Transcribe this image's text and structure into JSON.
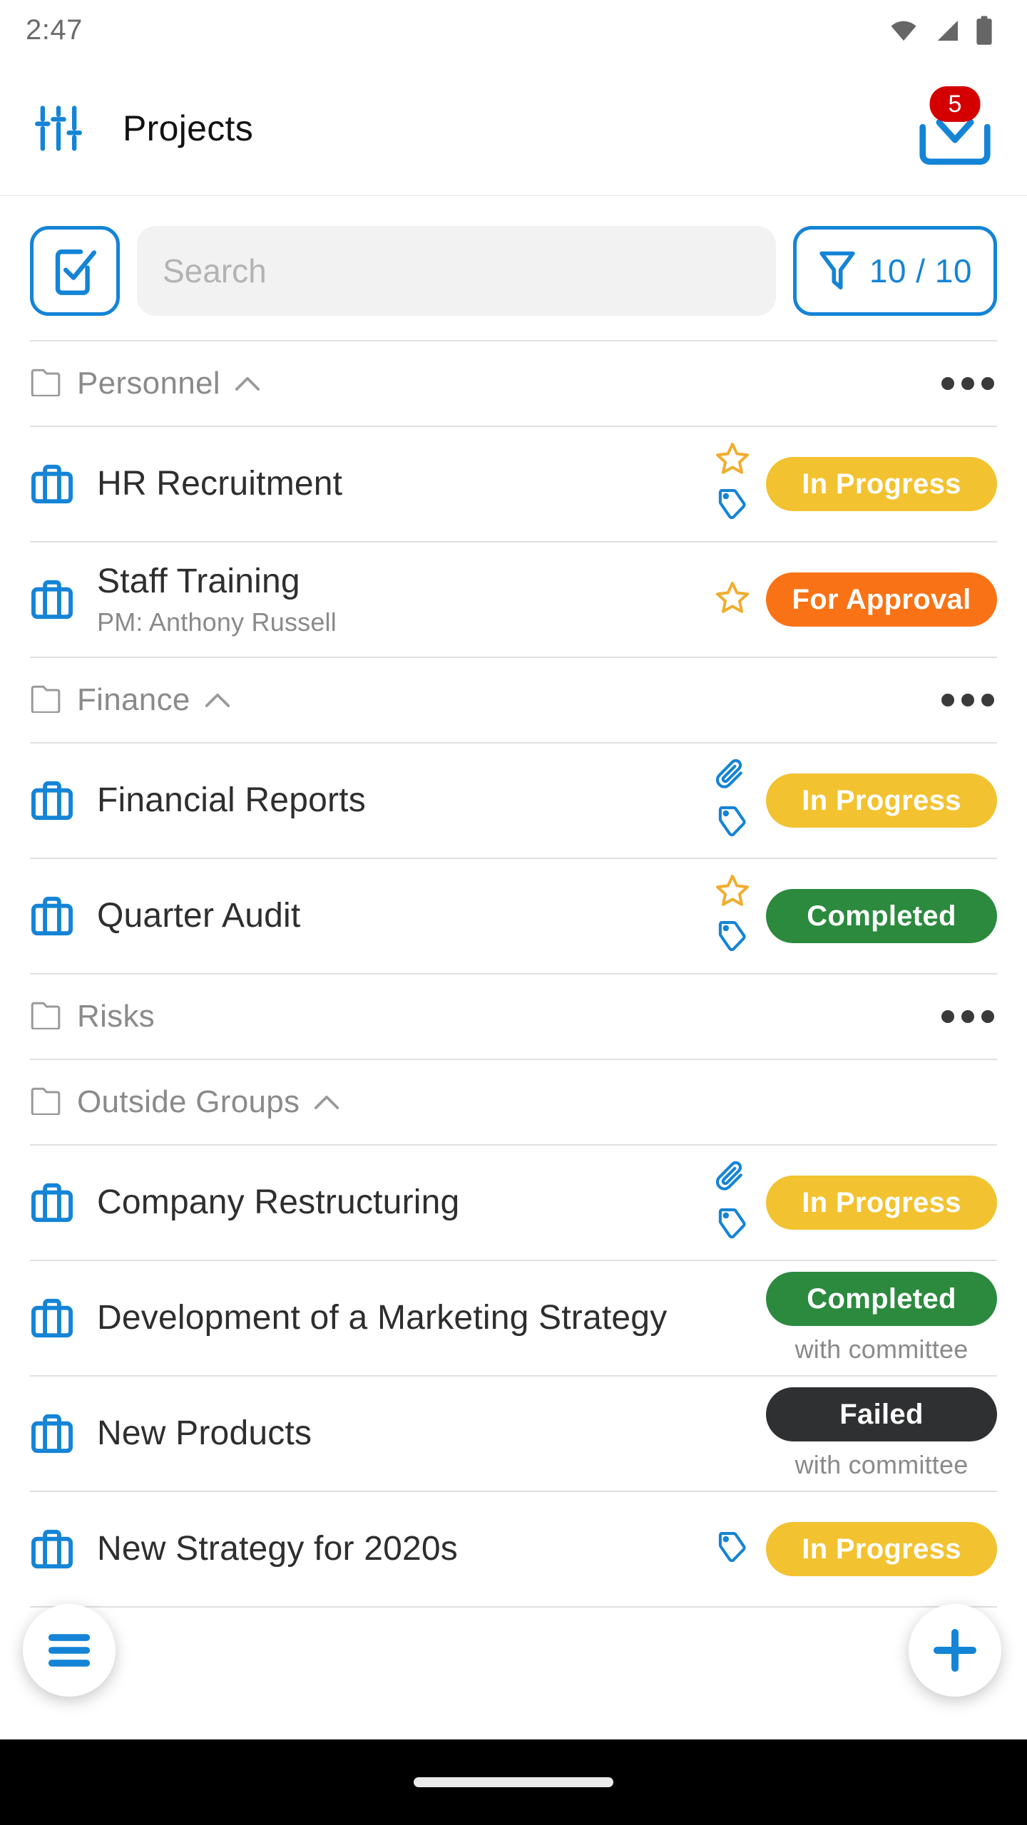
{
  "status_bar": {
    "time": "2:47",
    "icons": [
      "wifi-icon",
      "cellular-signal-icon",
      "battery-icon"
    ]
  },
  "app_bar": {
    "menu_icon": "sliders-icon",
    "title": "Projects",
    "inbox_icon": "inbox-download-icon",
    "inbox_badge": "5"
  },
  "toolbar": {
    "select_icon": "checkbox-select-icon",
    "search_placeholder": "Search",
    "search_value": "",
    "filter_icon": "funnel-filter-icon",
    "filter_count": "10 / 10"
  },
  "colors": {
    "accent_blue": "#1484d6",
    "in_progress": "#f2c230",
    "for_approval": "#f97316",
    "completed": "#2b8a3e",
    "failed": "#2f3031",
    "badge_red": "#d40000",
    "star_gold": "#f0ad2e",
    "muted_gray": "#8a8a8a"
  },
  "groups": [
    {
      "name": "Personnel",
      "folder_icon": "folder-icon",
      "collapsible": true,
      "expanded": true,
      "has_menu": true,
      "projects": [
        {
          "title": "HR Recruitment",
          "subtitle": "",
          "icon": "briefcase-icon",
          "marks": [
            "star-icon",
            "tag-icon"
          ],
          "status": "In Progress",
          "status_color": "#f2c230",
          "status_note": ""
        },
        {
          "title": "Staff Training",
          "subtitle": "PM: Anthony Russell",
          "icon": "briefcase-icon",
          "marks": [
            "star-icon"
          ],
          "status": "For Approval",
          "status_color": "#f97316",
          "status_note": ""
        }
      ]
    },
    {
      "name": "Finance",
      "folder_icon": "folder-icon",
      "collapsible": true,
      "expanded": true,
      "has_menu": true,
      "projects": [
        {
          "title": "Financial Reports",
          "subtitle": "",
          "icon": "briefcase-icon",
          "marks": [
            "paperclip-icon",
            "tag-icon"
          ],
          "status": "In Progress",
          "status_color": "#f2c230",
          "status_note": ""
        },
        {
          "title": "Quarter Audit",
          "subtitle": "",
          "icon": "briefcase-icon",
          "marks": [
            "star-icon",
            "tag-icon"
          ],
          "status": "Completed",
          "status_color": "#2b8a3e",
          "status_note": ""
        }
      ]
    },
    {
      "name": "Risks",
      "folder_icon": "folder-icon",
      "collapsible": false,
      "expanded": false,
      "has_menu": true,
      "projects": []
    },
    {
      "name": "Outside Groups",
      "folder_icon": "folder-icon",
      "collapsible": true,
      "expanded": true,
      "has_menu": false,
      "projects": [
        {
          "title": "Company Restructuring",
          "subtitle": "",
          "icon": "briefcase-icon",
          "marks": [
            "paperclip-icon",
            "tag-icon"
          ],
          "status": "In Progress",
          "status_color": "#f2c230",
          "status_note": ""
        },
        {
          "title": "Development of a Marketing Strategy",
          "subtitle": "",
          "icon": "briefcase-icon",
          "marks": [],
          "status": "Completed",
          "status_color": "#2b8a3e",
          "status_note": "with committee"
        },
        {
          "title": "New Products",
          "subtitle": "",
          "icon": "briefcase-icon",
          "marks": [],
          "status": "Failed",
          "status_color": "#2f3031",
          "status_note": "with committee"
        },
        {
          "title": "New Strategy for 2020s",
          "subtitle": "",
          "icon": "briefcase-icon",
          "marks": [
            "tag-icon"
          ],
          "status": "In Progress",
          "status_color": "#f2c230",
          "status_note": ""
        }
      ]
    }
  ],
  "fabs": {
    "menu_icon": "hamburger-menu-icon",
    "add_icon": "plus-icon"
  },
  "nav_bar": {
    "gesture_indicator": "home-gesture-pill"
  }
}
